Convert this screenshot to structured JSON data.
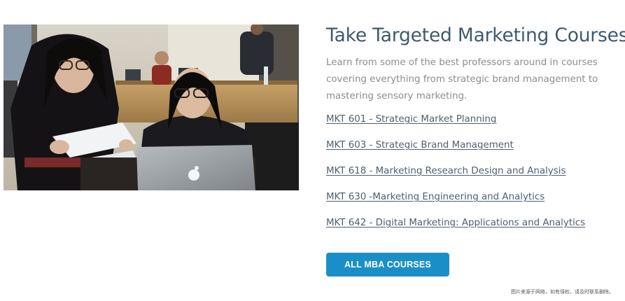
{
  "section": {
    "title": "Take Targeted Marketing Courses",
    "intro": "Learn from some of the best professors around in courses covering everything from strategic brand management to mastering sensory marketing."
  },
  "courses": [
    {
      "label": "MKT 601 - Strategic Market Planning"
    },
    {
      "label": "MKT 603 - Strategic Brand Management"
    },
    {
      "label": "MKT 618 - Marketing Research Design and Analysis"
    },
    {
      "label": "MKT 630 -Marketing Engineering and Analytics"
    },
    {
      "label": "MKT 642 - Digital Marketing: Applications and Analytics"
    }
  ],
  "cta": {
    "label": "ALL MBA COURSES"
  },
  "watermark": "图片来源于网络，如有侵权，请及时联系删除。",
  "colors": {
    "title": "#3f5a70",
    "body_text": "#8c8c8c",
    "link": "#4f5f6e",
    "button": "#1a8fc7"
  }
}
